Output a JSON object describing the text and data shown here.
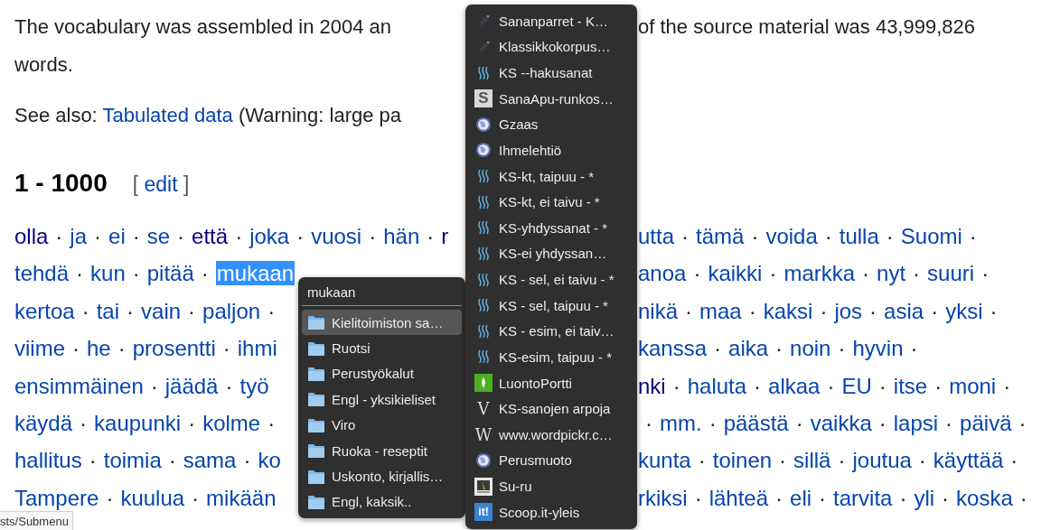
{
  "intro_lines": [
    {
      "left": "The vocabulary was assembled in 2004 an",
      "right": "of the source material was 43,999,826"
    },
    {
      "left": "words."
    }
  ],
  "see_also": {
    "before": "See also: ",
    "link": "Tabulated data",
    "after": " (Warning: large pa"
  },
  "section": {
    "title": "1 - 1000",
    "edit_open": "[",
    "edit_label": "edit",
    "edit_close": "]"
  },
  "word_rows": [
    {
      "left": [
        {
          "kind": "link",
          "t": "olla",
          "visited": true
        },
        {
          "kind": "sep",
          "t": "·"
        },
        {
          "kind": "link",
          "t": "ja",
          "visited": false
        },
        {
          "kind": "sep",
          "t": "·"
        },
        {
          "kind": "link",
          "t": "ei",
          "visited": false
        },
        {
          "kind": "sep",
          "t": "·"
        },
        {
          "kind": "link",
          "t": "se",
          "visited": false
        },
        {
          "kind": "sep",
          "t": "·"
        },
        {
          "kind": "link",
          "t": "että",
          "visited": true
        },
        {
          "kind": "sep",
          "t": "·"
        },
        {
          "kind": "link",
          "t": "joka",
          "visited": false
        },
        {
          "kind": "sep",
          "t": "·"
        },
        {
          "kind": "link",
          "t": "vuosi",
          "visited": false
        },
        {
          "kind": "sep",
          "t": "·"
        },
        {
          "kind": "link",
          "t": "hän",
          "visited": false
        },
        {
          "kind": "sep",
          "t": "·"
        },
        {
          "kind": "link",
          "t": "r",
          "visited": true
        }
      ],
      "right": [
        {
          "kind": "link",
          "t": "utta",
          "visited": false
        },
        {
          "kind": "sep",
          "t": "·"
        },
        {
          "kind": "link",
          "t": "tämä",
          "visited": false
        },
        {
          "kind": "sep",
          "t": "·"
        },
        {
          "kind": "link",
          "t": "voida",
          "visited": false
        },
        {
          "kind": "sep",
          "t": "·"
        },
        {
          "kind": "link",
          "t": "tulla",
          "visited": false
        },
        {
          "kind": "sep",
          "t": "·"
        },
        {
          "kind": "link",
          "t": "Suomi",
          "visited": false
        },
        {
          "kind": "sep",
          "t": "·"
        }
      ]
    },
    {
      "left": [
        {
          "kind": "link",
          "t": "tehdä",
          "visited": false
        },
        {
          "kind": "sep",
          "t": "·"
        },
        {
          "kind": "link",
          "t": "kun",
          "visited": false
        },
        {
          "kind": "sep",
          "t": "·"
        },
        {
          "kind": "link",
          "t": "pitää",
          "visited": false
        },
        {
          "kind": "sep",
          "t": "·"
        },
        {
          "kind": "selection",
          "t": "mukaan"
        }
      ],
      "right": [
        {
          "kind": "link",
          "t": "anoa",
          "visited": false
        },
        {
          "kind": "sep",
          "t": "·"
        },
        {
          "kind": "link",
          "t": "kaikki",
          "visited": false
        },
        {
          "kind": "sep",
          "t": "·"
        },
        {
          "kind": "link",
          "t": "markka",
          "visited": false
        },
        {
          "kind": "sep",
          "t": "·"
        },
        {
          "kind": "link",
          "t": "nyt",
          "visited": false
        },
        {
          "kind": "sep",
          "t": "·"
        },
        {
          "kind": "link",
          "t": "suuri",
          "visited": false
        },
        {
          "kind": "sep",
          "t": "·"
        }
      ]
    },
    {
      "left": [
        {
          "kind": "link",
          "t": "kertoa",
          "visited": false
        },
        {
          "kind": "sep",
          "t": "·"
        },
        {
          "kind": "link",
          "t": "tai",
          "visited": false
        },
        {
          "kind": "sep",
          "t": "·"
        },
        {
          "kind": "link",
          "t": "vain",
          "visited": false
        },
        {
          "kind": "sep",
          "t": "·"
        },
        {
          "kind": "link",
          "t": "paljon",
          "visited": false
        },
        {
          "kind": "sep",
          "t": "·"
        }
      ],
      "right": [
        {
          "kind": "link",
          "t": "nikä",
          "visited": false
        },
        {
          "kind": "sep",
          "t": "·"
        },
        {
          "kind": "link",
          "t": "maa",
          "visited": false
        },
        {
          "kind": "sep",
          "t": "·"
        },
        {
          "kind": "link",
          "t": "kaksi",
          "visited": false
        },
        {
          "kind": "sep",
          "t": "·"
        },
        {
          "kind": "link",
          "t": "jos",
          "visited": false
        },
        {
          "kind": "sep",
          "t": "·"
        },
        {
          "kind": "link",
          "t": "asia",
          "visited": false
        },
        {
          "kind": "sep",
          "t": "·"
        },
        {
          "kind": "link",
          "t": "yksi",
          "visited": false
        },
        {
          "kind": "sep",
          "t": "·"
        }
      ]
    },
    {
      "left": [
        {
          "kind": "link",
          "t": "viime",
          "visited": false
        },
        {
          "kind": "sep",
          "t": "·"
        },
        {
          "kind": "link",
          "t": "he",
          "visited": false
        },
        {
          "kind": "sep",
          "t": "·"
        },
        {
          "kind": "link",
          "t": "prosentti",
          "visited": false
        },
        {
          "kind": "sep",
          "t": "·"
        },
        {
          "kind": "link",
          "t": "ihmi",
          "visited": false
        }
      ],
      "right": [
        {
          "kind": "link",
          "t": "kanssa",
          "visited": false
        },
        {
          "kind": "sep",
          "t": "·"
        },
        {
          "kind": "link",
          "t": "aika",
          "visited": false
        },
        {
          "kind": "sep",
          "t": "·"
        },
        {
          "kind": "link",
          "t": "noin",
          "visited": false
        },
        {
          "kind": "sep",
          "t": "·"
        },
        {
          "kind": "link",
          "t": "hyvin",
          "visited": false
        },
        {
          "kind": "sep",
          "t": "·"
        }
      ]
    },
    {
      "left": [
        {
          "kind": "link",
          "t": "ensimmäinen",
          "visited": false
        },
        {
          "kind": "sep",
          "t": "·"
        },
        {
          "kind": "link",
          "t": "jäädä",
          "visited": false
        },
        {
          "kind": "sep",
          "t": "·"
        },
        {
          "kind": "link",
          "t": "työ",
          "visited": false
        }
      ],
      "right": [
        {
          "kind": "link",
          "t": "nki",
          "visited": true
        },
        {
          "kind": "sep",
          "t": "·"
        },
        {
          "kind": "link",
          "t": "haluta",
          "visited": false
        },
        {
          "kind": "sep",
          "t": "·"
        },
        {
          "kind": "link",
          "t": "alkaa",
          "visited": false
        },
        {
          "kind": "sep",
          "t": "·"
        },
        {
          "kind": "link",
          "t": "EU",
          "visited": false
        },
        {
          "kind": "sep",
          "t": "·"
        },
        {
          "kind": "link",
          "t": "itse",
          "visited": false
        },
        {
          "kind": "sep",
          "t": "·"
        },
        {
          "kind": "link",
          "t": "moni",
          "visited": false
        },
        {
          "kind": "sep",
          "t": "·"
        }
      ]
    },
    {
      "left": [
        {
          "kind": "link",
          "t": "käydä",
          "visited": false
        },
        {
          "kind": "sep",
          "t": "·"
        },
        {
          "kind": "link",
          "t": "kaupunki",
          "visited": false
        },
        {
          "kind": "sep",
          "t": "·"
        },
        {
          "kind": "link",
          "t": "kolme",
          "visited": false
        },
        {
          "kind": "sep",
          "t": "·"
        }
      ],
      "right": [
        {
          "kind": "sep",
          "t": "·"
        },
        {
          "kind": "link",
          "t": "mm.",
          "visited": false
        },
        {
          "kind": "sep",
          "t": "·"
        },
        {
          "kind": "link",
          "t": "päästä",
          "visited": false
        },
        {
          "kind": "sep",
          "t": "·"
        },
        {
          "kind": "link",
          "t": "vaikka",
          "visited": false
        },
        {
          "kind": "sep",
          "t": "·"
        },
        {
          "kind": "link",
          "t": "lapsi",
          "visited": false
        },
        {
          "kind": "sep",
          "t": "·"
        },
        {
          "kind": "link",
          "t": "päivä",
          "visited": false
        },
        {
          "kind": "sep",
          "t": "·"
        }
      ]
    },
    {
      "left": [
        {
          "kind": "link",
          "t": "hallitus",
          "visited": false
        },
        {
          "kind": "sep",
          "t": "·"
        },
        {
          "kind": "link",
          "t": "toimia",
          "visited": false
        },
        {
          "kind": "sep",
          "t": "·"
        },
        {
          "kind": "link",
          "t": "sama",
          "visited": false
        },
        {
          "kind": "sep",
          "t": "·"
        },
        {
          "kind": "link",
          "t": "ko",
          "visited": false
        }
      ],
      "right": [
        {
          "kind": "link",
          "t": "kunta",
          "visited": false
        },
        {
          "kind": "sep",
          "t": "·"
        },
        {
          "kind": "link",
          "t": "toinen",
          "visited": false
        },
        {
          "kind": "sep",
          "t": "·"
        },
        {
          "kind": "link",
          "t": "sillä",
          "visited": false
        },
        {
          "kind": "sep",
          "t": "·"
        },
        {
          "kind": "link",
          "t": "joutua",
          "visited": false
        },
        {
          "kind": "sep",
          "t": "·"
        },
        {
          "kind": "link",
          "t": "käyttää",
          "visited": false
        },
        {
          "kind": "sep",
          "t": "·"
        }
      ]
    },
    {
      "left": [
        {
          "kind": "link",
          "t": "Tampere",
          "visited": false
        },
        {
          "kind": "sep",
          "t": "·"
        },
        {
          "kind": "link",
          "t": "kuulua",
          "visited": false
        },
        {
          "kind": "sep",
          "t": "·"
        },
        {
          "kind": "link",
          "t": "mikään",
          "visited": false
        }
      ],
      "right": [
        {
          "kind": "link",
          "t": "rkiksi",
          "visited": false
        },
        {
          "kind": "sep",
          "t": "·"
        },
        {
          "kind": "link",
          "t": "lähteä",
          "visited": false
        },
        {
          "kind": "sep",
          "t": "·"
        },
        {
          "kind": "link",
          "t": "eli",
          "visited": false
        },
        {
          "kind": "sep",
          "t": "·"
        },
        {
          "kind": "link",
          "t": "tarvita",
          "visited": false
        },
        {
          "kind": "sep",
          "t": "·"
        },
        {
          "kind": "link",
          "t": "yli",
          "visited": false
        },
        {
          "kind": "sep",
          "t": "·"
        },
        {
          "kind": "link",
          "t": "koska",
          "visited": false
        },
        {
          "kind": "sep",
          "t": "·"
        }
      ]
    }
  ],
  "context_menu": {
    "items": [
      {
        "label": "Sananparret - K…",
        "kind": "bird"
      },
      {
        "label": "Klassikkokorpus…",
        "kind": "bird"
      },
      {
        "label": "KS --hakusanat",
        "kind": "waves"
      },
      {
        "label": "SanaApu-runkos…",
        "kind": "letter",
        "icon_text": "S"
      },
      {
        "label": "Gzaas",
        "kind": "globe"
      },
      {
        "label": "Ihmelehtiö",
        "kind": "globe"
      },
      {
        "label": "KS-kt, taipuu - *",
        "kind": "waves"
      },
      {
        "label": "KS-kt, ei taivu - *",
        "kind": "waves"
      },
      {
        "label": "KS-yhdyssanat - *",
        "kind": "waves"
      },
      {
        "label": "KS-ei yhdyssan…",
        "kind": "waves"
      },
      {
        "label": "KS - sel, ei taivu - *",
        "kind": "waves"
      },
      {
        "label": "KS - sel, taipuu - *",
        "kind": "waves"
      },
      {
        "label": "KS - esim, ei taiv…",
        "kind": "waves"
      },
      {
        "label": "KS-esim, taipuu - *",
        "kind": "waves"
      },
      {
        "label": "LuontoPortti",
        "kind": "leaf"
      },
      {
        "label": "KS-sanojen arpoja",
        "kind": "glyph",
        "icon_text": "V"
      },
      {
        "label": "www.wordpickr.c…",
        "kind": "glyph",
        "icon_text": "W"
      },
      {
        "label": "Perusmuoto",
        "kind": "globe"
      },
      {
        "label": "Su-ru",
        "kind": "photo"
      },
      {
        "label": "Scoop.it-yleis",
        "kind": "letter-blue",
        "icon_text": "it!"
      }
    ]
  },
  "submenu": {
    "header": "mukaan",
    "items": [
      {
        "label": "Kielitoimiston sa…",
        "selected": true
      },
      {
        "label": "Ruotsi",
        "selected": false
      },
      {
        "label": "Perustyökalut",
        "selected": false
      },
      {
        "label": "Engl - yksikieliset",
        "selected": false
      },
      {
        "label": "Viro",
        "selected": false
      },
      {
        "label": "Ruoka - reseptit",
        "selected": false
      },
      {
        "label": "Uskonto, kirjallis…",
        "selected": false
      },
      {
        "label": "Engl, kaksik..",
        "selected": false
      }
    ]
  },
  "status_tip": "sts/Submenu"
}
